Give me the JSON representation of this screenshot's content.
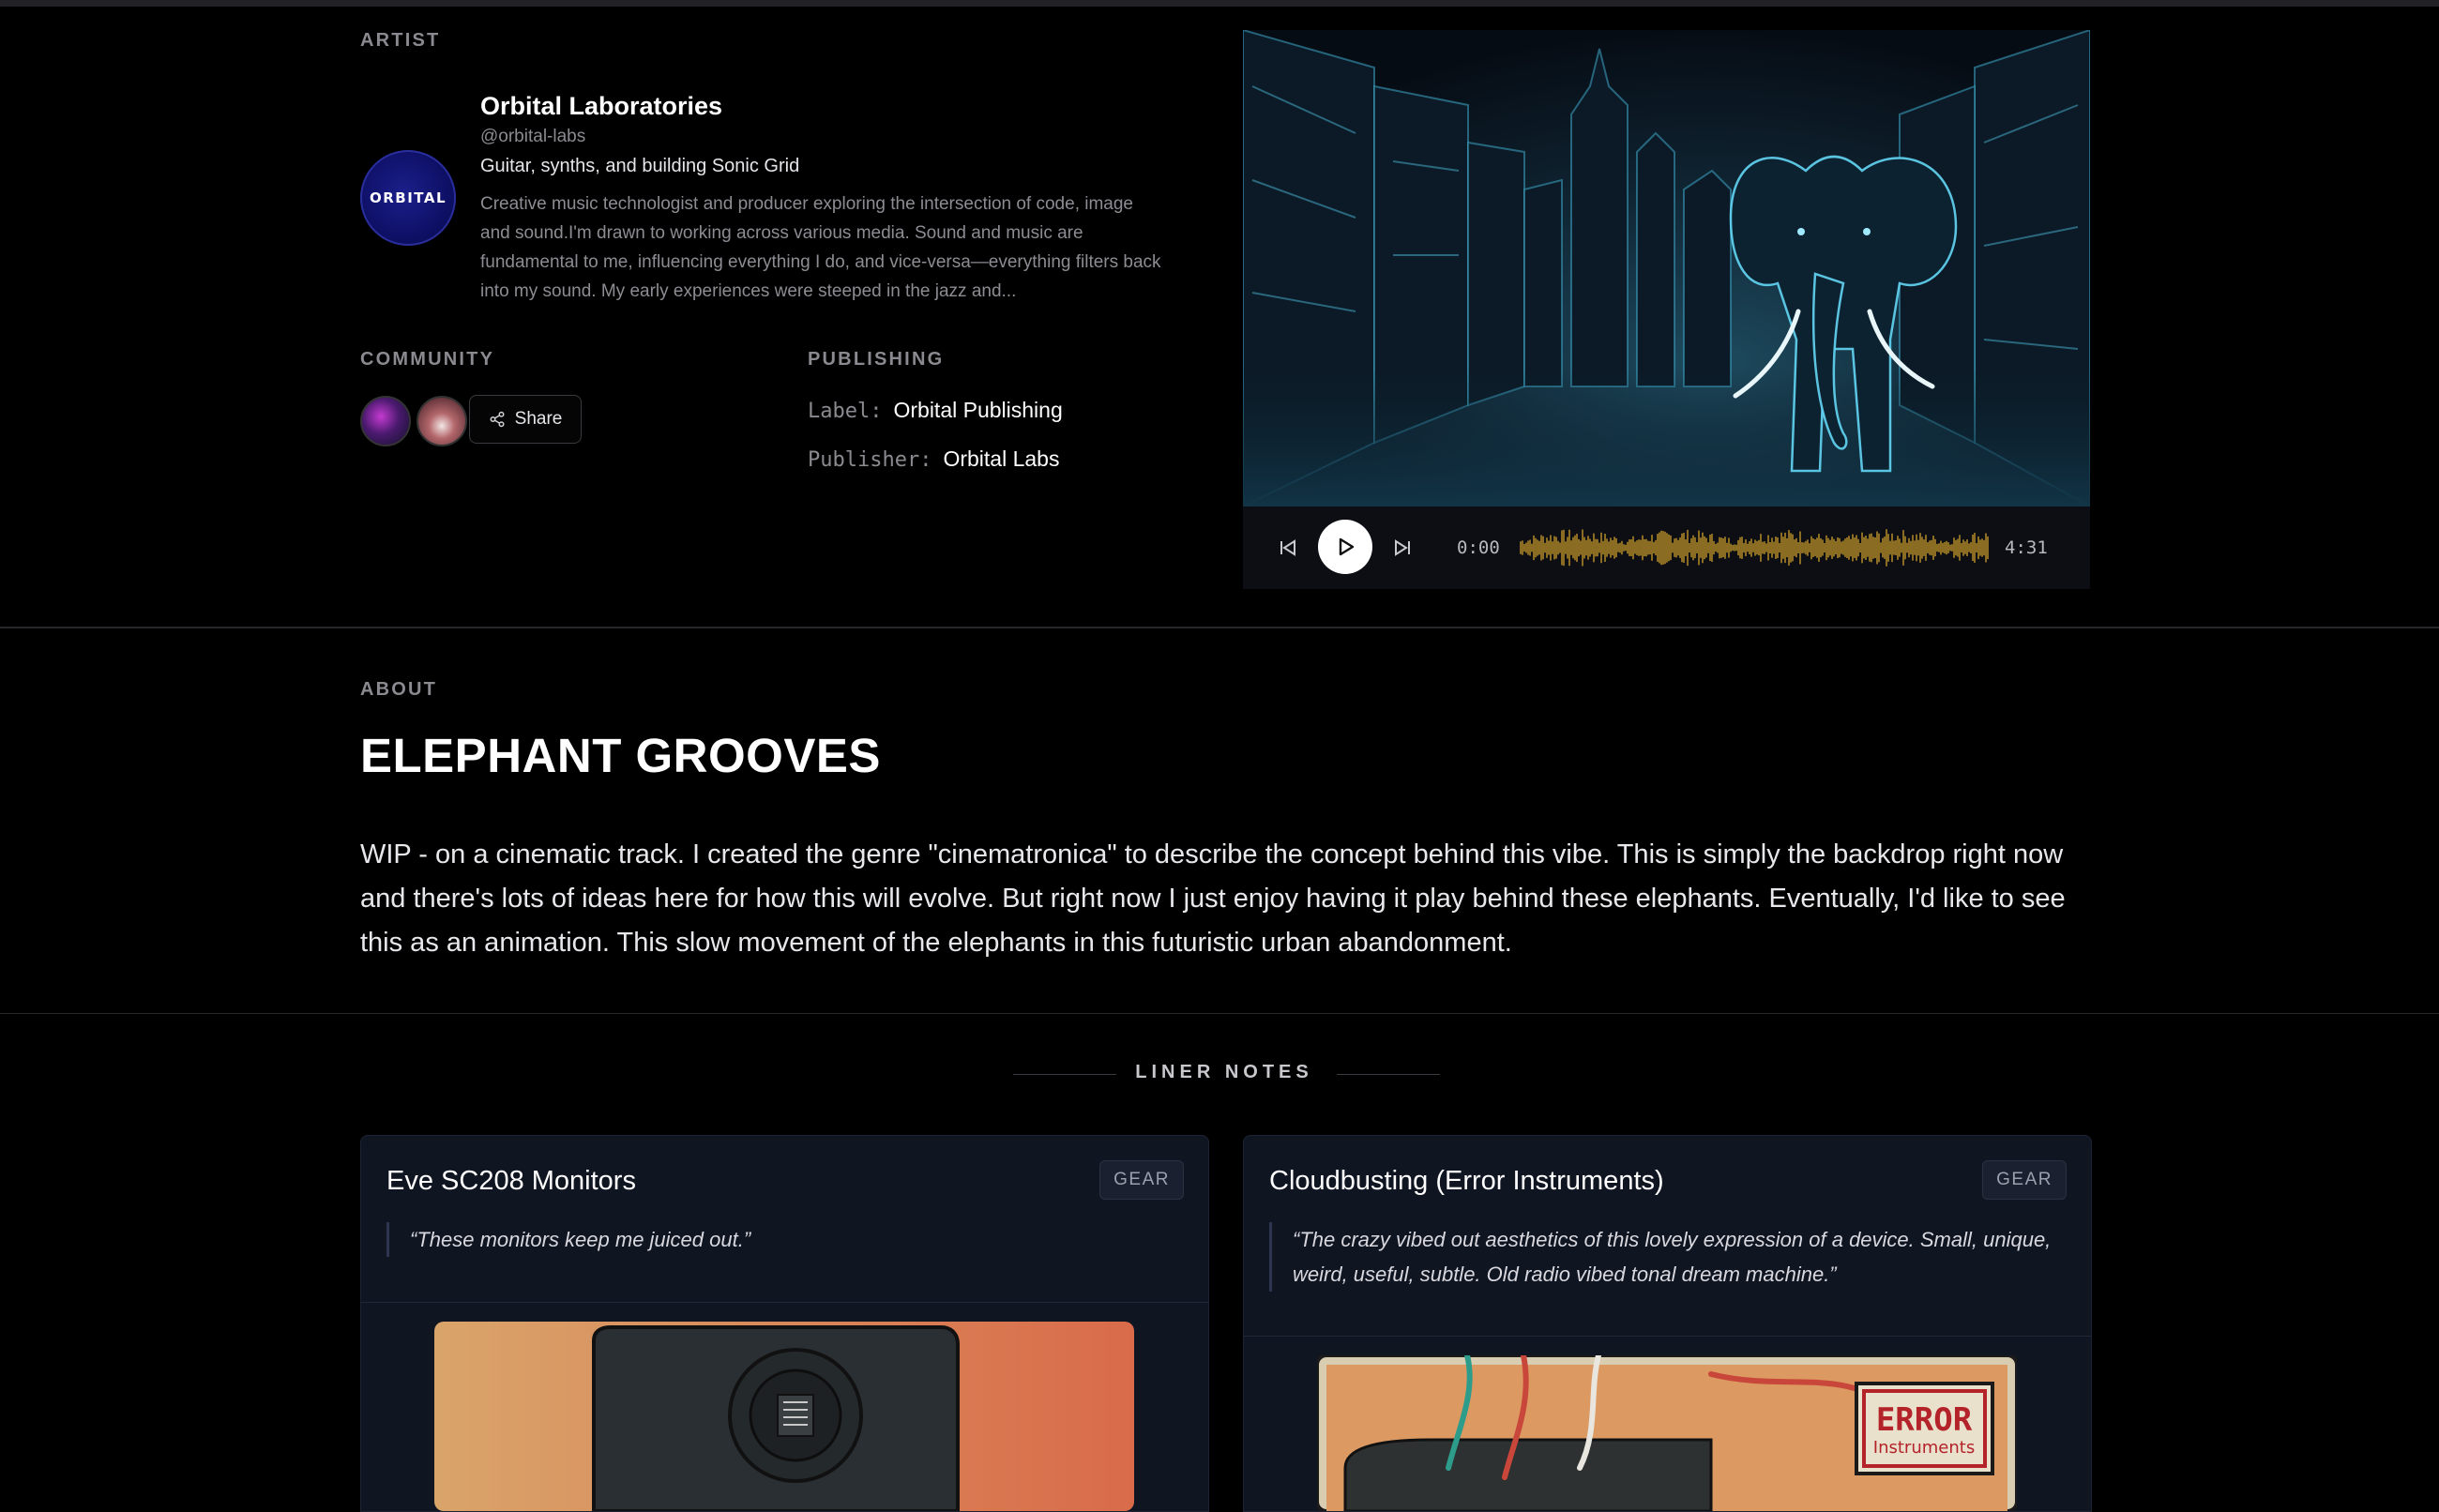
{
  "artist": {
    "section_label": "ARTIST",
    "avatar_text": "ORBITAL",
    "name": "Orbital Laboratories",
    "handle": "@orbital-labs",
    "tagline": "Guitar, synths, and building Sonic Grid",
    "bio": "Creative music technologist and producer exploring the intersection of code, image and sound.I'm drawn to working across various media. Sound and music are fundamental to me, influencing everything I do, and vice-versa—everything filters back into my sound. My early experiences were steeped in the jazz and..."
  },
  "community": {
    "section_label": "COMMUNITY",
    "share_label": "Share"
  },
  "publishing": {
    "section_label": "PUBLISHING",
    "label_key": "Label:",
    "label_value": "Orbital Publishing",
    "publisher_key": "Publisher:",
    "publisher_value": "Orbital Labs"
  },
  "player": {
    "current_time": "0:00",
    "duration": "4:31",
    "progress": 0,
    "waveform_color": "#8a6d22"
  },
  "about": {
    "section_label": "ABOUT",
    "title": "ELEPHANT GROOVES",
    "text": "WIP - on a cinematic track. I created the genre \"cinematronica\" to describe the concept behind this vibe. This is simply the backdrop right now and there's lots of ideas here for how this will evolve. But right now I just enjoy having it play behind these elephants. Eventually, I'd like to see this as an animation. This slow movement of the elephants in this futuristic urban abandonment."
  },
  "liner_notes": {
    "title": "LINER NOTES",
    "cards": [
      {
        "title": "Eve SC208 Monitors",
        "badge": "GEAR",
        "quote": "“These monitors keep me juiced out.”"
      },
      {
        "title": "Cloudbusting (Error Instruments)",
        "badge": "GEAR",
        "quote": "“The crazy vibed out aesthetics of this lovely expression of a device. Small, unique, weird, useful, subtle. Old radio vibed tonal dream machine.”",
        "image_logo_top": "ERROR",
        "image_logo_bottom": "Instruments"
      }
    ]
  }
}
